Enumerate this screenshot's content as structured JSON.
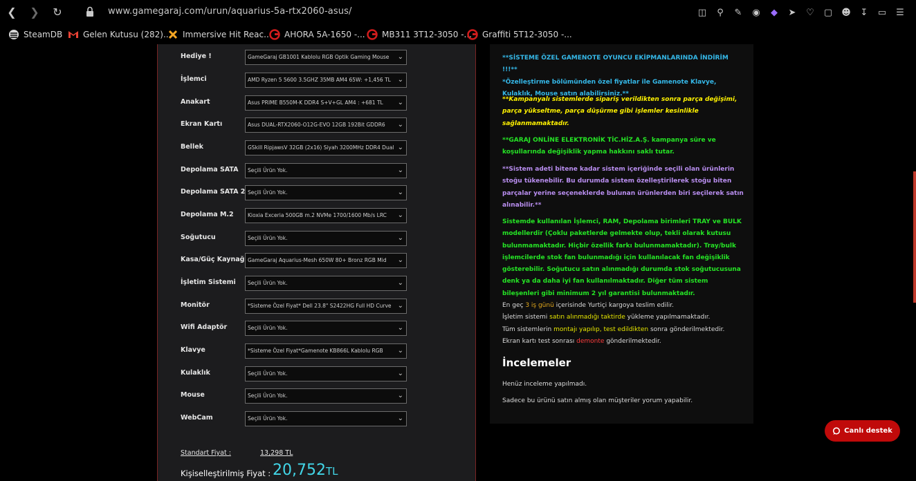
{
  "browser": {
    "url": "www.gamegaraj.com/urun/aquarius-5a-rtx2060-asus/",
    "bookmarks": [
      {
        "label": "SteamDB",
        "icon": "steam-icon"
      },
      {
        "label": "Gelen Kutusu (282)...",
        "icon": "gmail-icon"
      },
      {
        "label": "Immersive Hit Reac...",
        "icon": "puzzle-icon"
      },
      {
        "label": "AHORA 5A-1650 -...",
        "icon": "gamegaraj-icon"
      },
      {
        "label": "MB311 3T12-3050 -...",
        "icon": "gamegaraj-icon"
      },
      {
        "label": "Graffiti 5T12-3050 -...",
        "icon": "gamegaraj-icon"
      }
    ]
  },
  "configurator": {
    "rows": [
      {
        "label": "Hediye !",
        "value": "GameGaraj GB1001 Kablolu RGB Optik Gaming Mouse"
      },
      {
        "label": "İşlemci",
        "value": "AMD Ryzen 5 5600 3.5GHZ 35MB AM4 65W: +1,456 TL"
      },
      {
        "label": "Anakart",
        "value": "Asus PRIME B550M-K DDR4 S+V+GL AM4 : +681 TL"
      },
      {
        "label": "Ekran Kartı",
        "value": "Asus DUAL-RTX2060-O12G-EVO 12GB 192Bit GDDR6"
      },
      {
        "label": "Bellek",
        "value": "GSkill RipjawsV 32GB (2x16) Siyah 3200MHz DDR4 Dual"
      },
      {
        "label": "Depolama SATA",
        "value": "Seçili Ürün Yok."
      },
      {
        "label": "Depolama SATA 2",
        "value": "Seçili Ürün Yok."
      },
      {
        "label": "Depolama M.2",
        "value": "Kioxia Exceria 500GB m.2 NVMe 1700/1600 Mb/s LRC"
      },
      {
        "label": "Soğutucu",
        "value": "Seçili Ürün Yok."
      },
      {
        "label": "Kasa/Güç Kaynağı",
        "value": "GameGaraj Aquarius-Mesh 650W 80+ Bronz RGB Mid"
      },
      {
        "label": "İşletim Sistemi",
        "value": "Seçili Ürün Yok."
      },
      {
        "label": "Monitör",
        "value": "*Sisteme Özel Fiyat* Dell 23.8\" S2422HG Full HD Curve"
      },
      {
        "label": "Wifi Adaptör",
        "value": "Seçili Ürün Yok."
      },
      {
        "label": "Klavye",
        "value": "*Sisteme Özel Fiyat*Gamenote KB866L Kablolu RGB"
      },
      {
        "label": "Kulaklık",
        "value": "Seçili Ürün Yok."
      },
      {
        "label": "Mouse",
        "value": "Seçili Ürün Yok."
      },
      {
        "label": "WebCam",
        "value": "Seçili Ürün Yok."
      }
    ],
    "standard_price_label": "Standart Fiyat :",
    "standard_price_value": "13,298 TL",
    "custom_price_label": "Kişiselleştirilmiş Fiyat :",
    "custom_price_value": "20,752",
    "custom_price_currency": "TL"
  },
  "info": {
    "p1": "**SİSTEME ÖZEL GAMENOTE OYUNCU EKİPMANLARINDA İNDİRİM !!!**",
    "p1b": "*Özelleştirme bölümünden özel fiyatlar ile Gamenote Klavye, Kulaklık, Mouse satın alabilirsiniz.**",
    "p2": "**Kampanyalı sistemlerde sipariş verildikten sonra parça değişimi, parça yükseltme, parça düşürme gibi işlemler kesinlikle sağlanmamaktadır.",
    "p3": "**GARAJ ONLİNE ELEKTRONİK TİC.HİZ.A.Ş. kampanya süre ve koşullarında değişiklik yapma hakkını saklı tutar.",
    "p4": "**Sistem adeti bitene kadar sistem içeriğinde seçili olan ürünlerin stoğu tükenebilir. Bu durumda sistem özelleştirilerek stoğu biten parçalar yerine seçeneklerde bulunan ürünlerden biri seçilerek satın alınabilir.**",
    "p5": "Sistemde kullanılan İşlemci, RAM, Depolama birimleri TRAY ve BULK modellerdir (Çoklu paketlerde gelmekte olup, tekli olarak kutusu bulunmamaktadır. Hiçbir özellik farkı bulunmamaktadır). Tray/bulk işlemcilerde stok fan bulunmadığı için kullanılacak fan değişiklik gösterebilir. Soğutucu satın alınmadığı durumda stok soğutucusuna denk ya da daha iyi fan kullanılmaktadır. Diğer tüm sistem bileşenleri gibi minimum 2 yıl garantisi bulunmaktadır.",
    "l1a": "En geç ",
    "l1b": "3 iş günü",
    "l1c": " içerisinde Yurtiçi kargoya teslim edilir.",
    "l2a": "İşletim sistemi ",
    "l2b": "satın alınmadığı taktirde",
    "l2c": " yükleme yapılmamaktadır.",
    "l3a": "Tüm sistemlerin ",
    "l3b": "montajı yapılıp, test edildikten",
    "l3c": " sonra gönderilmektedir.",
    "l4a": "Ekran kartı test sonrası ",
    "l4b": "demonte",
    "l4c": " gönderilmektedir."
  },
  "reviews": {
    "title": "İncelemeler",
    "none": "Henüz inceleme yapılmadı.",
    "note": "Sadece bu ürünü satın almış olan müşteriler yorum yapabilir."
  },
  "chat": {
    "label": "Canlı destek"
  }
}
